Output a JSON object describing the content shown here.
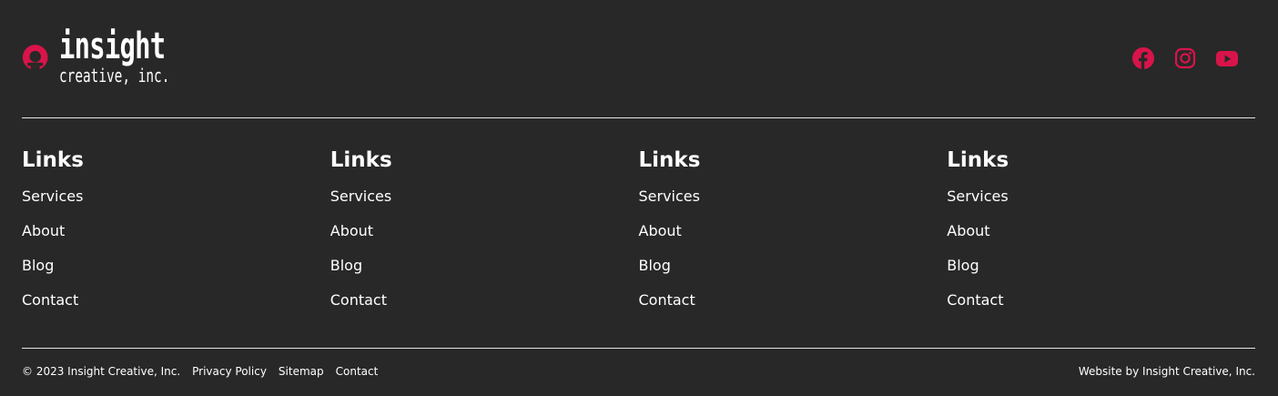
{
  "logo": {
    "word": "insight",
    "sub": "creative, inc."
  },
  "social": [
    {
      "name": "facebook",
      "icon": "facebook-icon"
    },
    {
      "name": "instagram",
      "icon": "instagram-icon"
    },
    {
      "name": "youtube",
      "icon": "youtube-icon"
    }
  ],
  "columns": [
    {
      "heading": "Links",
      "links": [
        "Services",
        "About",
        "Blog",
        "Contact"
      ]
    },
    {
      "heading": "Links",
      "links": [
        "Services",
        "About",
        "Blog",
        "Contact"
      ]
    },
    {
      "heading": "Links",
      "links": [
        "Services",
        "About",
        "Blog",
        "Contact"
      ]
    },
    {
      "heading": "Links",
      "links": [
        "Services",
        "About",
        "Blog",
        "Contact"
      ]
    }
  ],
  "bottom": {
    "copyright": "© 2023 Insight Creative, Inc.",
    "links": [
      "Privacy Policy",
      "Sitemap",
      "Contact"
    ],
    "credit": "Website by Insight Creative, Inc."
  },
  "colors": {
    "background": "#282828",
    "accent": "#d8144a",
    "text": "#ffffff",
    "divider": "#e6e6e6"
  }
}
